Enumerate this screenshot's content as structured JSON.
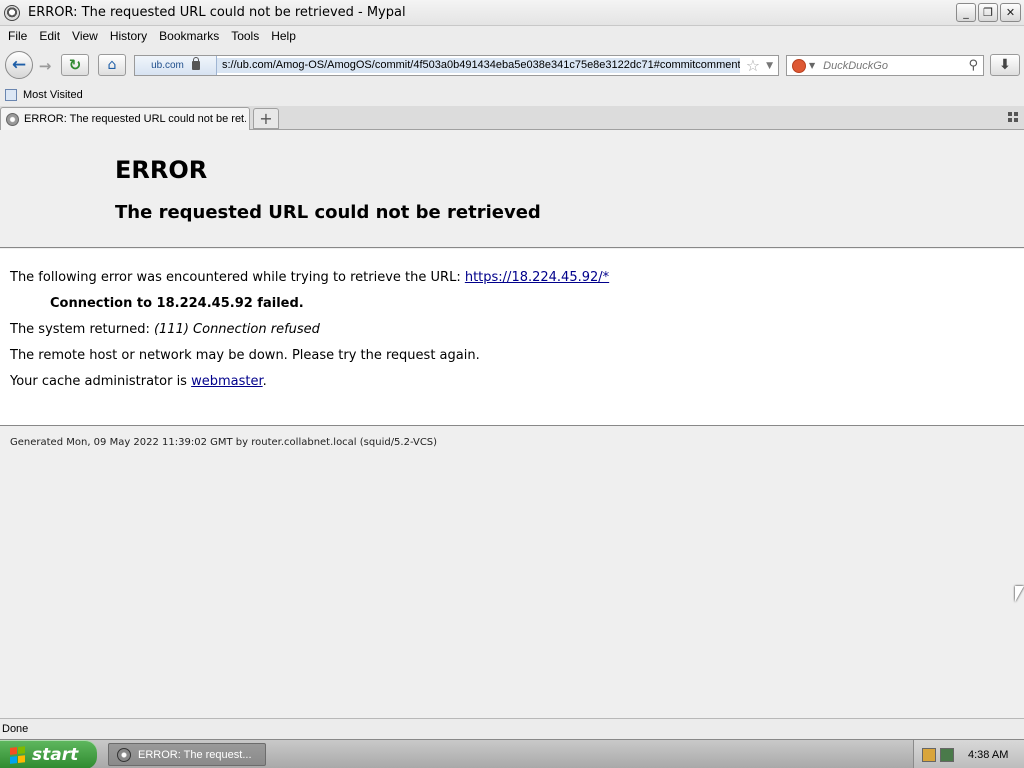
{
  "window": {
    "title": "ERROR: The requested URL could not be retrieved - Mypal",
    "buttons": {
      "minimize": "_",
      "restore": "❐",
      "close": "✕"
    }
  },
  "menu": {
    "items": [
      "File",
      "Edit",
      "View",
      "History",
      "Bookmarks",
      "Tools",
      "Help"
    ]
  },
  "navbar": {
    "back_glyph": "←",
    "forward_glyph": "→",
    "reload_glyph": "↻",
    "home_glyph": "⌂",
    "identity_host": "ub.com",
    "url": "s://ub.com/Amog-OS/AmogOS/commit/4f503a0b491434eba5e038e341c75e8e3122dc71#commitcomment-",
    "search_engine_placeholder": "DuckDuckGo",
    "download_glyph": "⬇"
  },
  "bookmarks": {
    "items": [
      "Most Visited"
    ]
  },
  "tabs": [
    {
      "label": "ERROR: The requested URL could not be ret...",
      "active": true
    }
  ],
  "page": {
    "title": "ERROR",
    "subtitle": "The requested URL could not be retrieved",
    "line1_prefix": "The following error was encountered while trying to retrieve the URL: ",
    "line1_link": "https://18.224.45.92/*",
    "line2": "Connection to 18.224.45.92 failed.",
    "line3_prefix": "The system returned: ",
    "line3_em": "(111) Connection refused",
    "line4": "The remote host or network may be down. Please try the request again.",
    "line5_prefix": "Your cache administrator is ",
    "line5_link": "webmaster",
    "line5_suffix": ".",
    "generated": "Generated Mon, 09 May 2022 11:39:02 GMT by router.collabnet.local (squid/5.2-VCS)"
  },
  "status": {
    "text": "Done"
  },
  "taskbar": {
    "start_label": "start",
    "task_label": "ERROR: The request...",
    "clock": "4:38 AM"
  },
  "colors": {
    "link": "#00008b",
    "start_green": "#2f8a2f",
    "content_bg": "#efefef"
  }
}
